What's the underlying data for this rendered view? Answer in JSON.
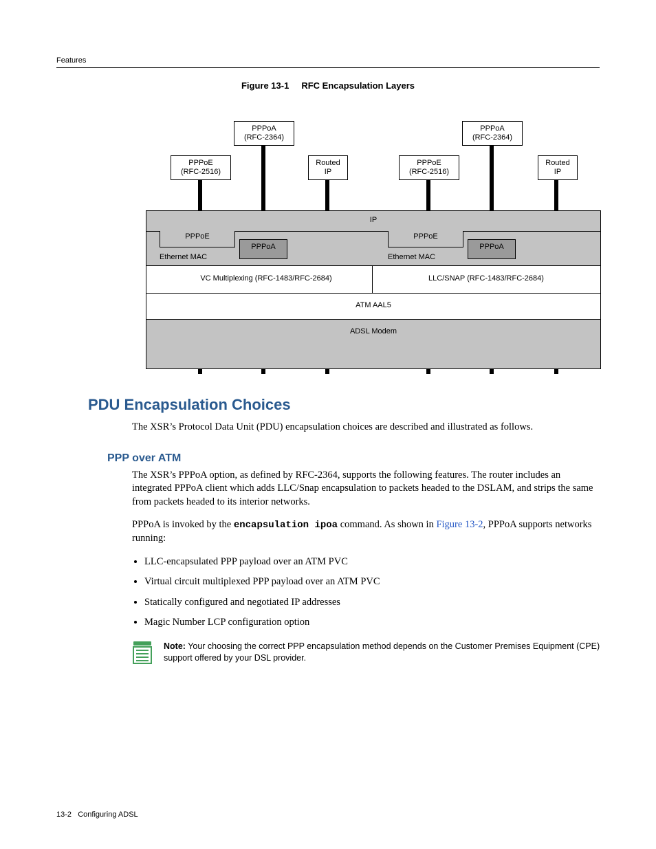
{
  "running_head": "Features",
  "figure": {
    "num": "Figure 13-1",
    "title": "RFC Encapsulation Layers"
  },
  "diagram": {
    "top": {
      "pppoa": {
        "l1": "PPPoA",
        "l2": "(RFC-2364)"
      },
      "pppoe": {
        "l1": "PPPoE",
        "l2": "(RFC-2516)"
      },
      "routedip": {
        "l1": "Routed",
        "l2": "IP"
      }
    },
    "layers": {
      "ip": "IP",
      "pppoe": "PPPoE",
      "pppoa": "PPPoA",
      "emac": "Ethernet MAC",
      "vc": "VC Multiplexing (RFC-1483/RFC-2684)",
      "llc": "LLC/SNAP (RFC-1483/RFC-2684)",
      "aal5": "ATM AAL5",
      "modem": "ADSL Modem"
    }
  },
  "h1": "PDU Encapsulation Choices",
  "intro": "The XSR’s Protocol Data Unit (PDU) encapsulation choices are described and illustrated as follows.",
  "h2": "PPP over ATM",
  "p1": "The XSR’s PPPoA option, as defined by RFC-2364, supports the following features. The router includes an integrated PPPoA client which adds LLC/Snap encapsulation to packets headed to the DSLAM, and strips the same from packets headed to its interior networks.",
  "p2a": "PPPoA is invoked by the ",
  "p2cmd": "encapsulation ipoa",
  "p2b": " command. As shown in ",
  "p2link": "Figure 13-2",
  "p2c": ", PPPoA supports networks running:",
  "bullets": [
    "LLC-encapsulated PPP payload over an ATM PVC",
    "Virtual circuit multiplexed PPP payload over an ATM PVC",
    "Statically configured and negotiated IP addresses",
    "Magic Number LCP configuration option"
  ],
  "note": {
    "lead": "Note:",
    "text": " Your choosing the correct PPP encapsulation method depends on the Customer Premises Equipment (CPE) support offered by your DSL provider."
  },
  "footer": {
    "pg": "13-2",
    "chapter": "Configuring ADSL"
  }
}
